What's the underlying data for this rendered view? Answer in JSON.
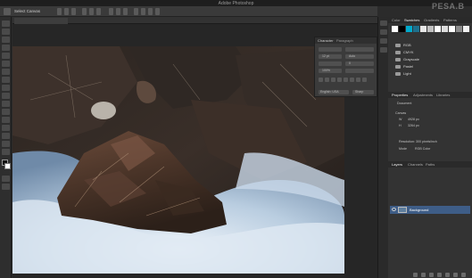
{
  "app": {
    "title": "Adobe Photoshop"
  },
  "options_bar": {
    "preset_label": "Select Canvas"
  },
  "character_panel": {
    "tabs": [
      "Character",
      "Paragraph"
    ],
    "font_size": "12 pt",
    "leading": "Auto",
    "tracking": "0",
    "scale": "100%",
    "language": "English: USA",
    "antialias": "Sharp"
  },
  "right_panels": {
    "top_tabs": [
      "Color",
      "Swatches",
      "Gradients",
      "Patterns"
    ],
    "active_top_tab": "Swatches",
    "swatch_groups": [
      "RGB",
      "CMYK",
      "Grayscale",
      "Pastel",
      "Light"
    ],
    "swatch_colors": [
      "#ffffff",
      "#000000",
      "#00aacc",
      "#1d6f8c",
      "#e8e8e8",
      "#c0c0c0",
      "#ffffff",
      "#dddddd",
      "#ffffff",
      "#8a8a8a",
      "#f2f2f2"
    ],
    "properties_tabs": [
      "Properties",
      "Adjustments",
      "Libraries"
    ],
    "properties": {
      "doc_label": "Document",
      "canvas_label": "Canvas",
      "width_label": "W",
      "width_value": "4928 px",
      "height_label": "H",
      "height_value": "3264 px",
      "resolution": "Resolution: 300 pixels/inch",
      "mode": "Mode",
      "mode_value": "RGB Color"
    },
    "layers_tabs": [
      "Layers",
      "Channels",
      "Paths"
    ],
    "layer": {
      "name": "Background"
    }
  },
  "watermark": "PESA.B",
  "colors": {
    "accent": "#3e5d87",
    "chrome": "#2b2b2b",
    "panel": "#333333"
  }
}
